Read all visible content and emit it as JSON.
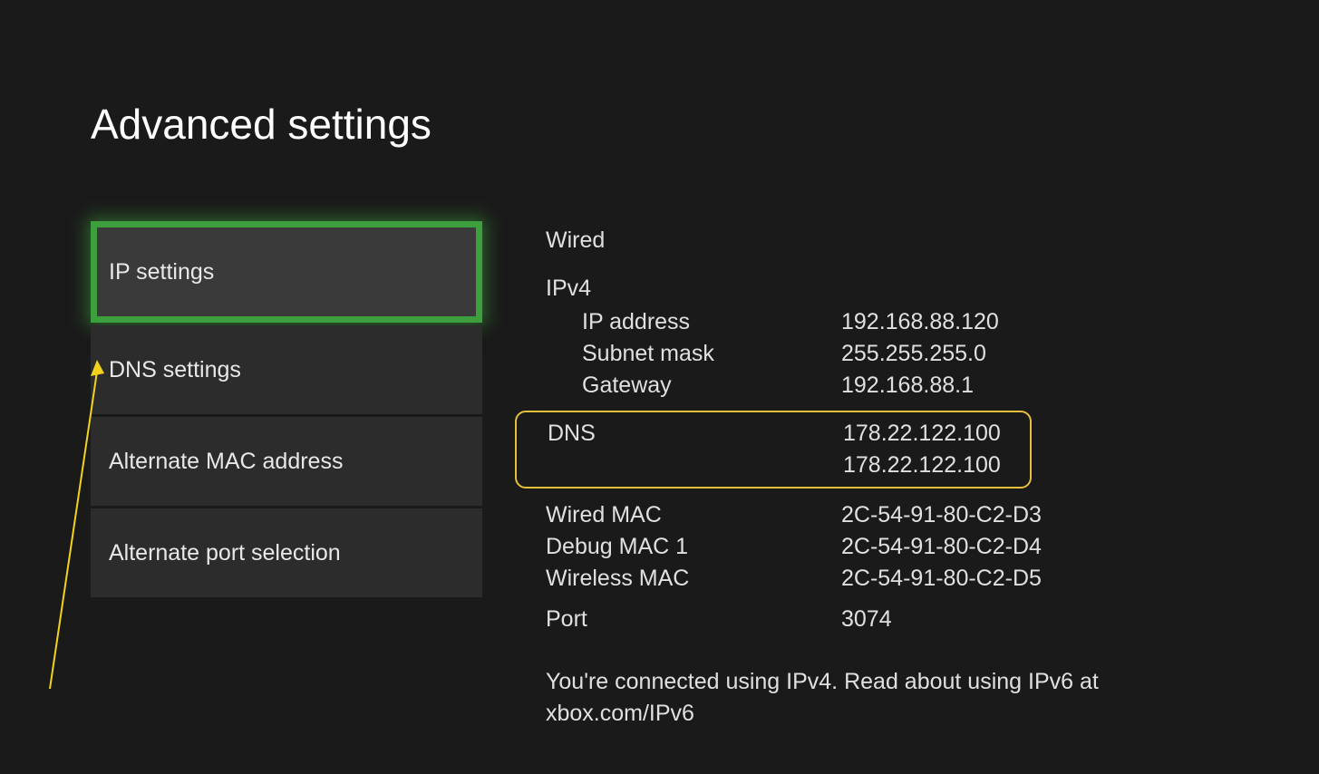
{
  "page": {
    "title": "Advanced settings"
  },
  "sidebar": {
    "items": [
      {
        "label": "IP settings",
        "selected": true
      },
      {
        "label": "DNS settings",
        "selected": false
      },
      {
        "label": "Alternate MAC address",
        "selected": false
      },
      {
        "label": "Alternate port selection",
        "selected": false
      }
    ]
  },
  "details": {
    "connection_type": "Wired",
    "ipv4_label": "IPv4",
    "ip_address": {
      "label": "IP address",
      "value": "192.168.88.120"
    },
    "subnet_mask": {
      "label": "Subnet mask",
      "value": "255.255.255.0"
    },
    "gateway": {
      "label": "Gateway",
      "value": "192.168.88.1"
    },
    "dns": {
      "label": "DNS",
      "primary": "178.22.122.100",
      "secondary": "178.22.122.100"
    },
    "wired_mac": {
      "label": "Wired MAC",
      "value": "2C-54-91-80-C2-D3"
    },
    "debug_mac": {
      "label": "Debug MAC 1",
      "value": "2C-54-91-80-C2-D4"
    },
    "wireless_mac": {
      "label": "Wireless MAC",
      "value": "2C-54-91-80-C2-D5"
    },
    "port": {
      "label": "Port",
      "value": "3074"
    },
    "footer": "You're connected using IPv4. Read about using IPv6 at xbox.com/IPv6"
  },
  "annotation": {
    "arrow_color": "#f2d21f",
    "dns_box_color": "#e5c13b",
    "selected_border_color": "#3d9f3d"
  }
}
